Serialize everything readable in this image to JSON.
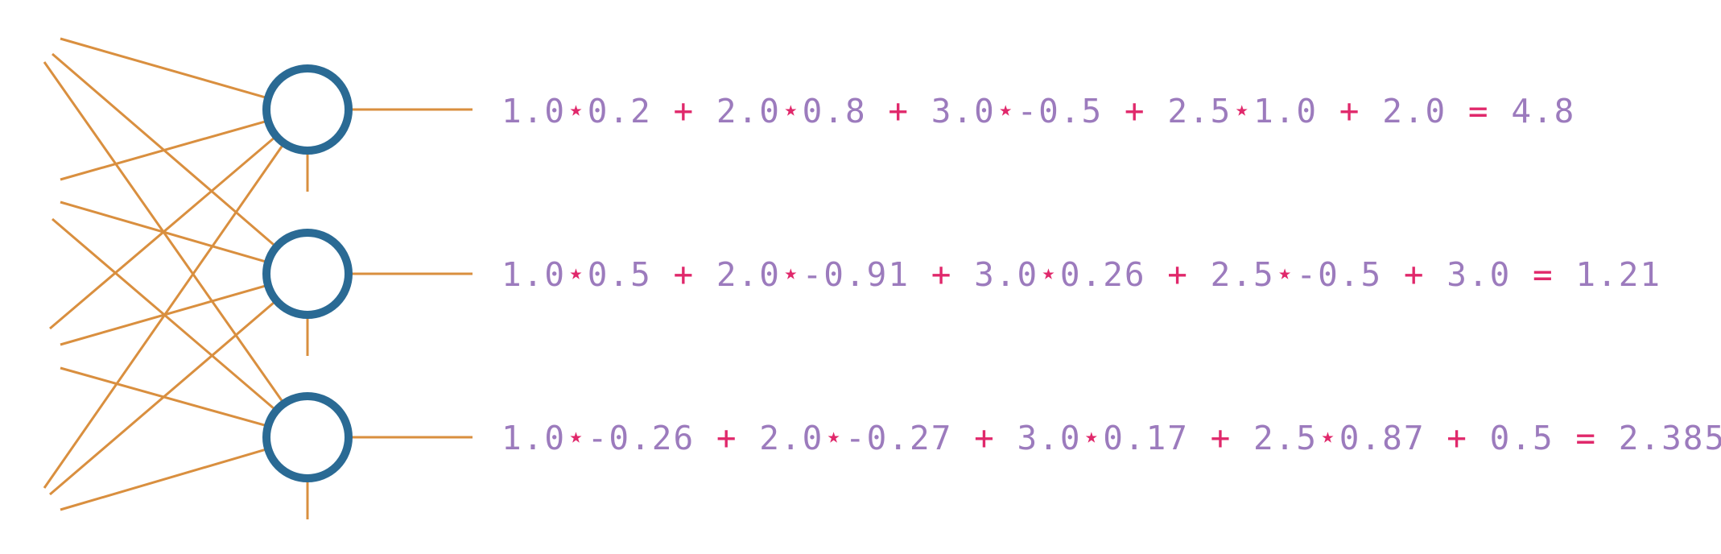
{
  "colors": {
    "connection": "#d98f3f",
    "neuron_ring": "#2a6a94",
    "number": "#9c7bbd",
    "operator": "#e0286b"
  },
  "neurons": [
    {
      "terms": [
        {
          "input": "1.0",
          "weight": "0.2"
        },
        {
          "input": "2.0",
          "weight": "0.8"
        },
        {
          "input": "3.0",
          "weight": "-0.5"
        },
        {
          "input": "2.5",
          "weight": "1.0"
        }
      ],
      "bias": "2.0",
      "output": "4.8"
    },
    {
      "terms": [
        {
          "input": "1.0",
          "weight": "0.5"
        },
        {
          "input": "2.0",
          "weight": "-0.91"
        },
        {
          "input": "3.0",
          "weight": "0.26"
        },
        {
          "input": "2.5",
          "weight": "-0.5"
        }
      ],
      "bias": "3.0",
      "output": "1.21"
    },
    {
      "terms": [
        {
          "input": "1.0",
          "weight": "-0.26"
        },
        {
          "input": "2.0",
          "weight": "-0.27"
        },
        {
          "input": "3.0",
          "weight": "0.17"
        },
        {
          "input": "2.5",
          "weight": "0.87"
        }
      ],
      "bias": "0.5",
      "output": "2.385"
    }
  ]
}
